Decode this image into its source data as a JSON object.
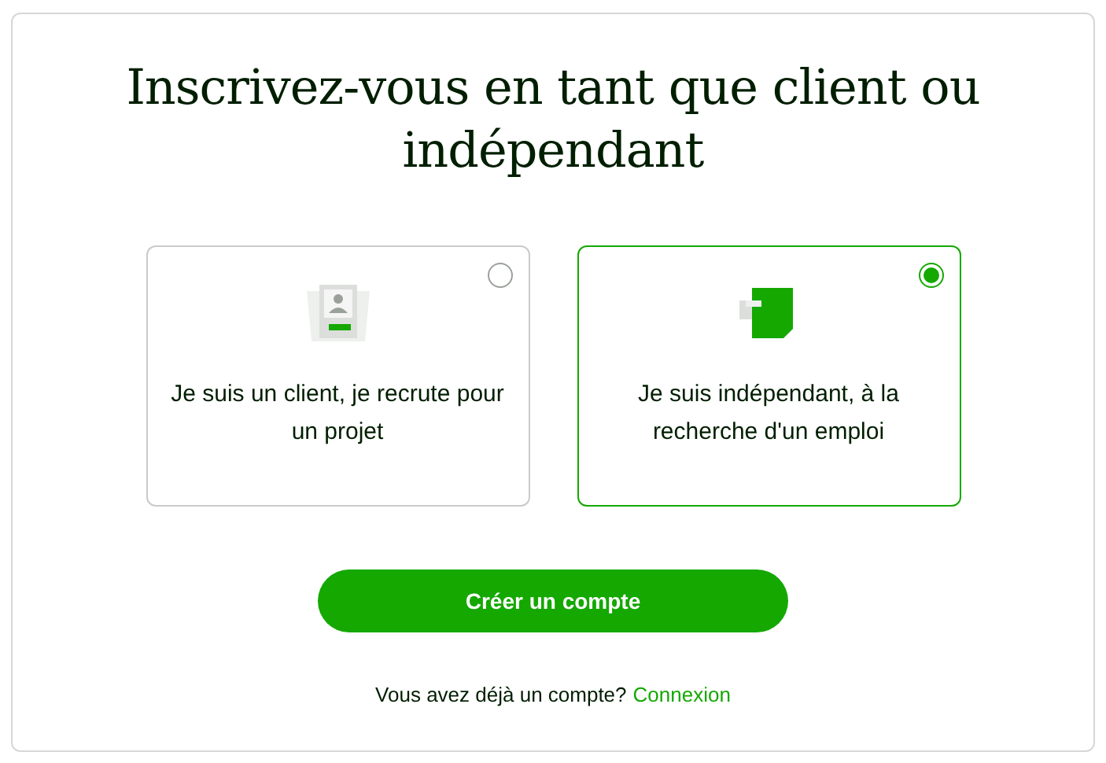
{
  "title": "Inscrivez-vous en tant que client ou indépendant",
  "options": [
    {
      "kind": "client",
      "label": "Je suis un client, je recrute pour un projet",
      "selected": false
    },
    {
      "kind": "freelancer",
      "label": "Je suis indépendant, à la recherche d'un emploi",
      "selected": true
    }
  ],
  "button": "Créer un compte",
  "footer": {
    "text": "Vous avez déjà un compte?",
    "link": "Connexion"
  }
}
